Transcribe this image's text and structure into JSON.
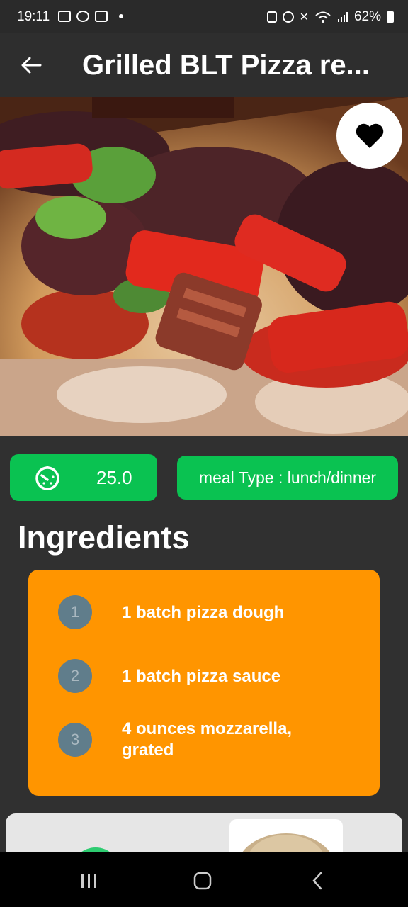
{
  "status": {
    "time": "19:11",
    "battery": "62%"
  },
  "header": {
    "title": "Grilled BLT Pizza re..."
  },
  "info": {
    "time_value": "25.0",
    "meal_type": "meal Type : lunch/dinner"
  },
  "ingredients": {
    "title": "Ingredients",
    "items": [
      {
        "num": "1",
        "text": "1 batch pizza dough"
      },
      {
        "num": "2",
        "text": "1 batch pizza sauce"
      },
      {
        "num": "3",
        "text": "4 ounces mozzarella, grated"
      }
    ]
  },
  "colors": {
    "accent_green": "#0ac251",
    "card_orange": "#ff9500",
    "badge_gray": "#607d8b"
  }
}
